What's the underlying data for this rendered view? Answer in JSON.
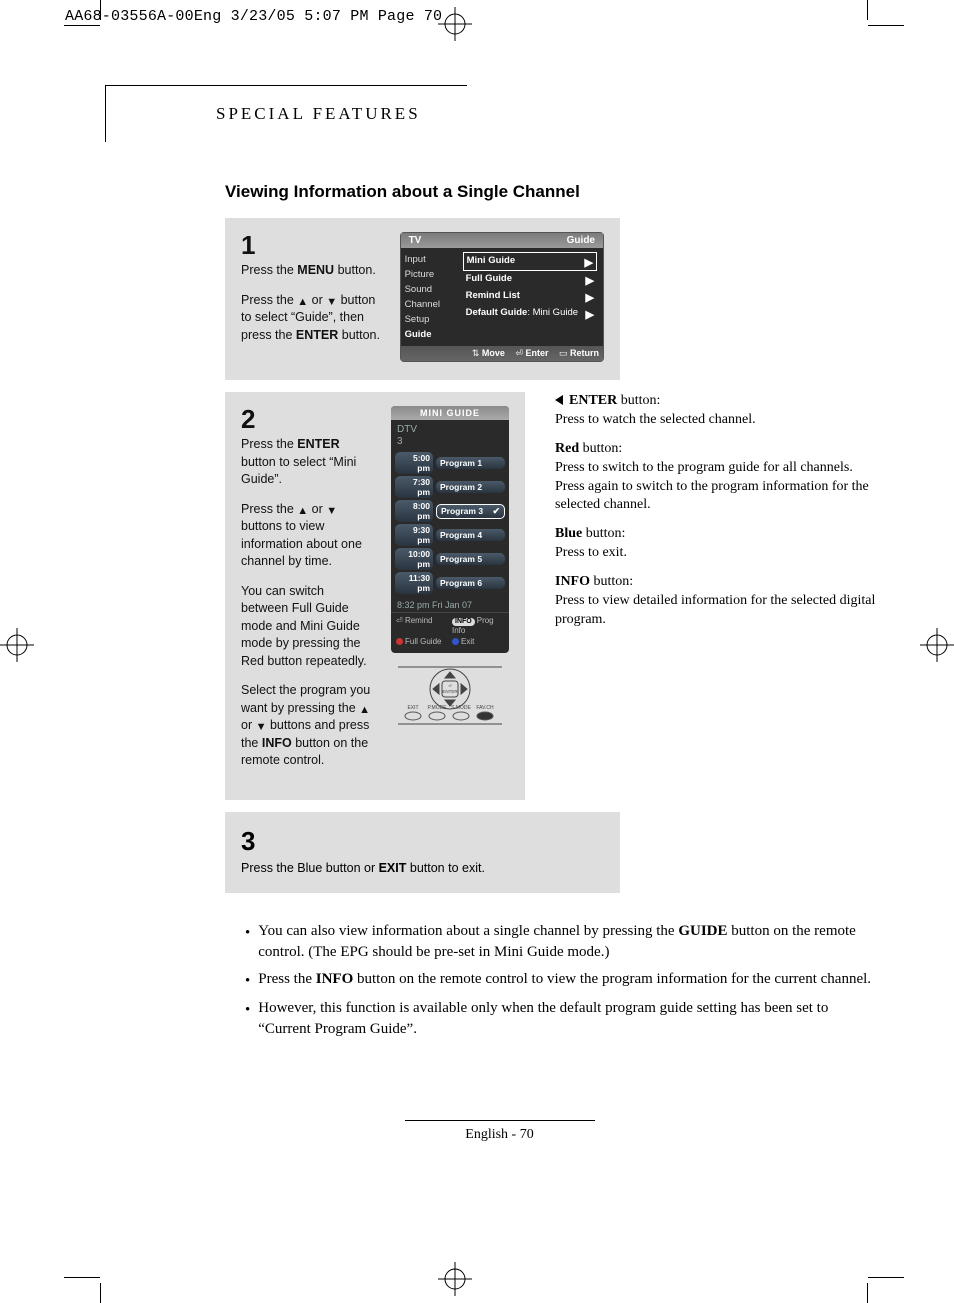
{
  "meta_header": "AA68-03556A-00Eng  3/23/05  5:07 PM  Page 70",
  "section_title": "SPECIAL FEATURES",
  "subtitle": "Viewing Information about a Single Channel",
  "step1": {
    "num": "1",
    "p1a": "Press the ",
    "p1b": "MENU",
    "p1c": " button.",
    "p2a": "Press the ",
    "p2b": " or ",
    "p2c": " button to select “Guide”, then press the ",
    "p2d": "ENTER",
    "p2e": " button."
  },
  "osd": {
    "title_left": "TV",
    "title_right": "Guide",
    "left_menu": [
      "Input",
      "Picture",
      "Sound",
      "Channel",
      "Setup",
      "Guide"
    ],
    "right_items": [
      {
        "label": "Mini Guide",
        "val": "",
        "sel": true
      },
      {
        "label": "Full Guide",
        "val": ""
      },
      {
        "label": "Remind List",
        "val": ""
      },
      {
        "label": "Default Guide",
        "val": ":   Mini Guide"
      }
    ],
    "bar": {
      "move": "Move",
      "enter": "Enter",
      "ret": "Return"
    }
  },
  "step2": {
    "num": "2",
    "p1a": "Press the ",
    "p1b": "ENTER",
    "p1c": " button to select “Mini  Guide”.",
    "p2a": "Press the ",
    "p2b": " or ",
    "p2c": " buttons to view information about one channel by time.",
    "p3": "You can switch between Full Guide mode and Mini Guide mode by pressing the Red button repeatedly.",
    "p4a": "Select the program you want by pressing the ",
    "p4b": " or ",
    "p4c": " buttons and press the ",
    "p4d": "INFO",
    "p4e": " button on the remote control."
  },
  "mini": {
    "title": "MINI GUIDE",
    "sub1": "DTV",
    "sub2": "3",
    "rows": [
      {
        "t": "5:00 pm",
        "p": "Program 1"
      },
      {
        "t": "7:30 pm",
        "p": "Program 2"
      },
      {
        "t": "8:00 pm",
        "p": "Program 3",
        "chk": true,
        "sel": true
      },
      {
        "t": "9:30 pm",
        "p": "Program 4"
      },
      {
        "t": "10:00 pm",
        "p": "Program 5"
      },
      {
        "t": "11:30 pm",
        "p": "Program 6"
      }
    ],
    "dt": "8:32 pm Fri Jan 07",
    "ft": {
      "remind": "Remind",
      "full": "Full Guide",
      "info": "Prog Info",
      "exit": "Exit",
      "infoLabel": "INFO",
      "enterIcon": "↵"
    }
  },
  "side": {
    "n1a": "ENTER",
    "n1b": " button:",
    "n1c": "Press to watch the selected channel.",
    "n2a": "Red",
    "n2b": " button:",
    "n2c": "Press to switch to the program guide for all channels.",
    "n2d": "Press again to switch to the program information for the selected channel.",
    "n3a": "Blue",
    "n3b": " button:",
    "n3c": "Press to exit.",
    "n4a": "INFO",
    "n4b": " button:",
    "n4c": "Press to view detailed information for the selected digital program."
  },
  "step3": {
    "num": "3",
    "p1a": "Press the Blue button or ",
    "p1b": "EXIT",
    "p1c": " button to exit."
  },
  "lower": {
    "b1a": "You can also view information about a single channel by pressing the ",
    "b1b": "GUIDE",
    "b1c": " button on the remote control. (The EPG should be pre-set in Mini Guide mode.)",
    "b2a": "Press the ",
    "b2b": "INFO",
    "b2c": " button on the remote control to view the program information for the current channel.",
    "b3": "However, this function is available only when the default program guide setting has been set to “Current Program Guide”."
  },
  "footer": "English - 70",
  "remote_labels": {
    "enter": "ENTER",
    "exit": "EXIT",
    "pmode": "P.MODE",
    "smode": "S.MODE",
    "favch": "FAV.CH"
  },
  "glyph": {
    "up": "▲",
    "down": "▼",
    "right": "▶",
    "updown": "⇅",
    "sel": "✔"
  }
}
